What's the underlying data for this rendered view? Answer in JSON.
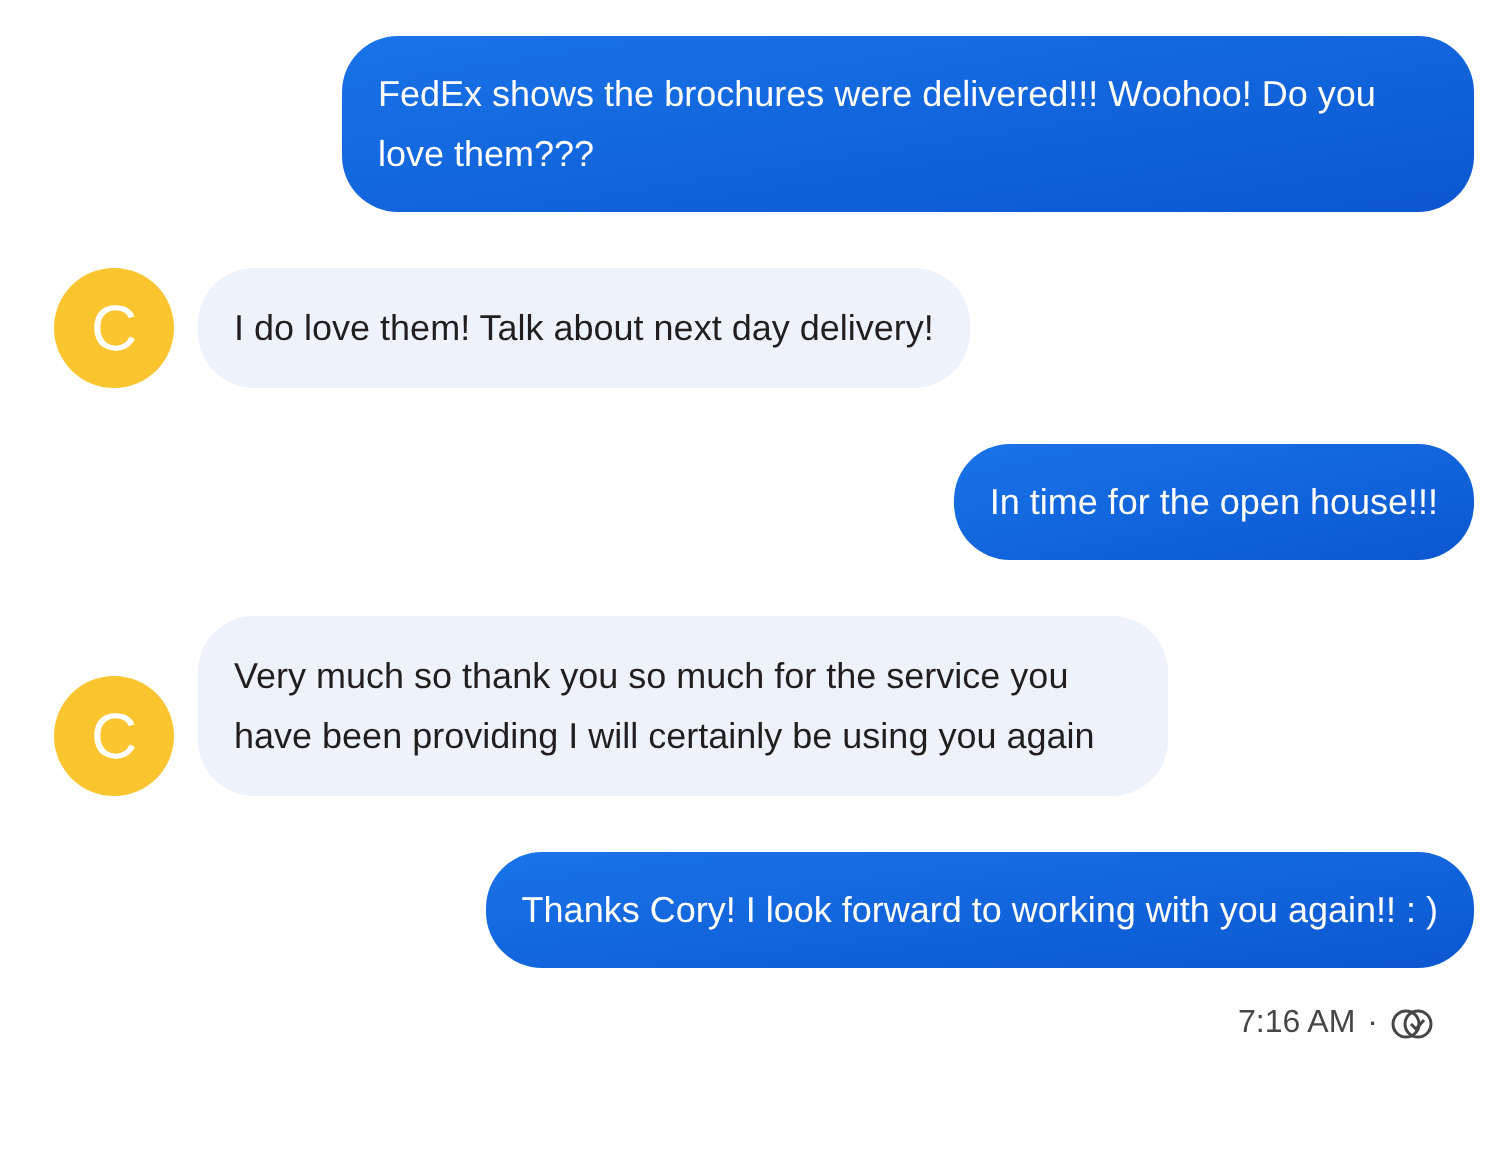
{
  "messages": [
    {
      "kind": "outgoing",
      "text": "FedEx shows the brochures were delivered!!! Woohoo! Do you love them???"
    },
    {
      "kind": "incoming",
      "avatar": "C",
      "text": "I do love them! Talk about next day delivery!"
    },
    {
      "kind": "outgoing",
      "text": "In time for the open house!!!"
    },
    {
      "kind": "incoming",
      "avatar": "C",
      "text": "Very much so thank you so much for the service you have been providing I will certainly be using you again"
    },
    {
      "kind": "outgoing",
      "text": "Thanks Cory! I look forward to working with you again!! : )"
    }
  ],
  "status": {
    "time": "7:16 AM",
    "separator": "·"
  }
}
